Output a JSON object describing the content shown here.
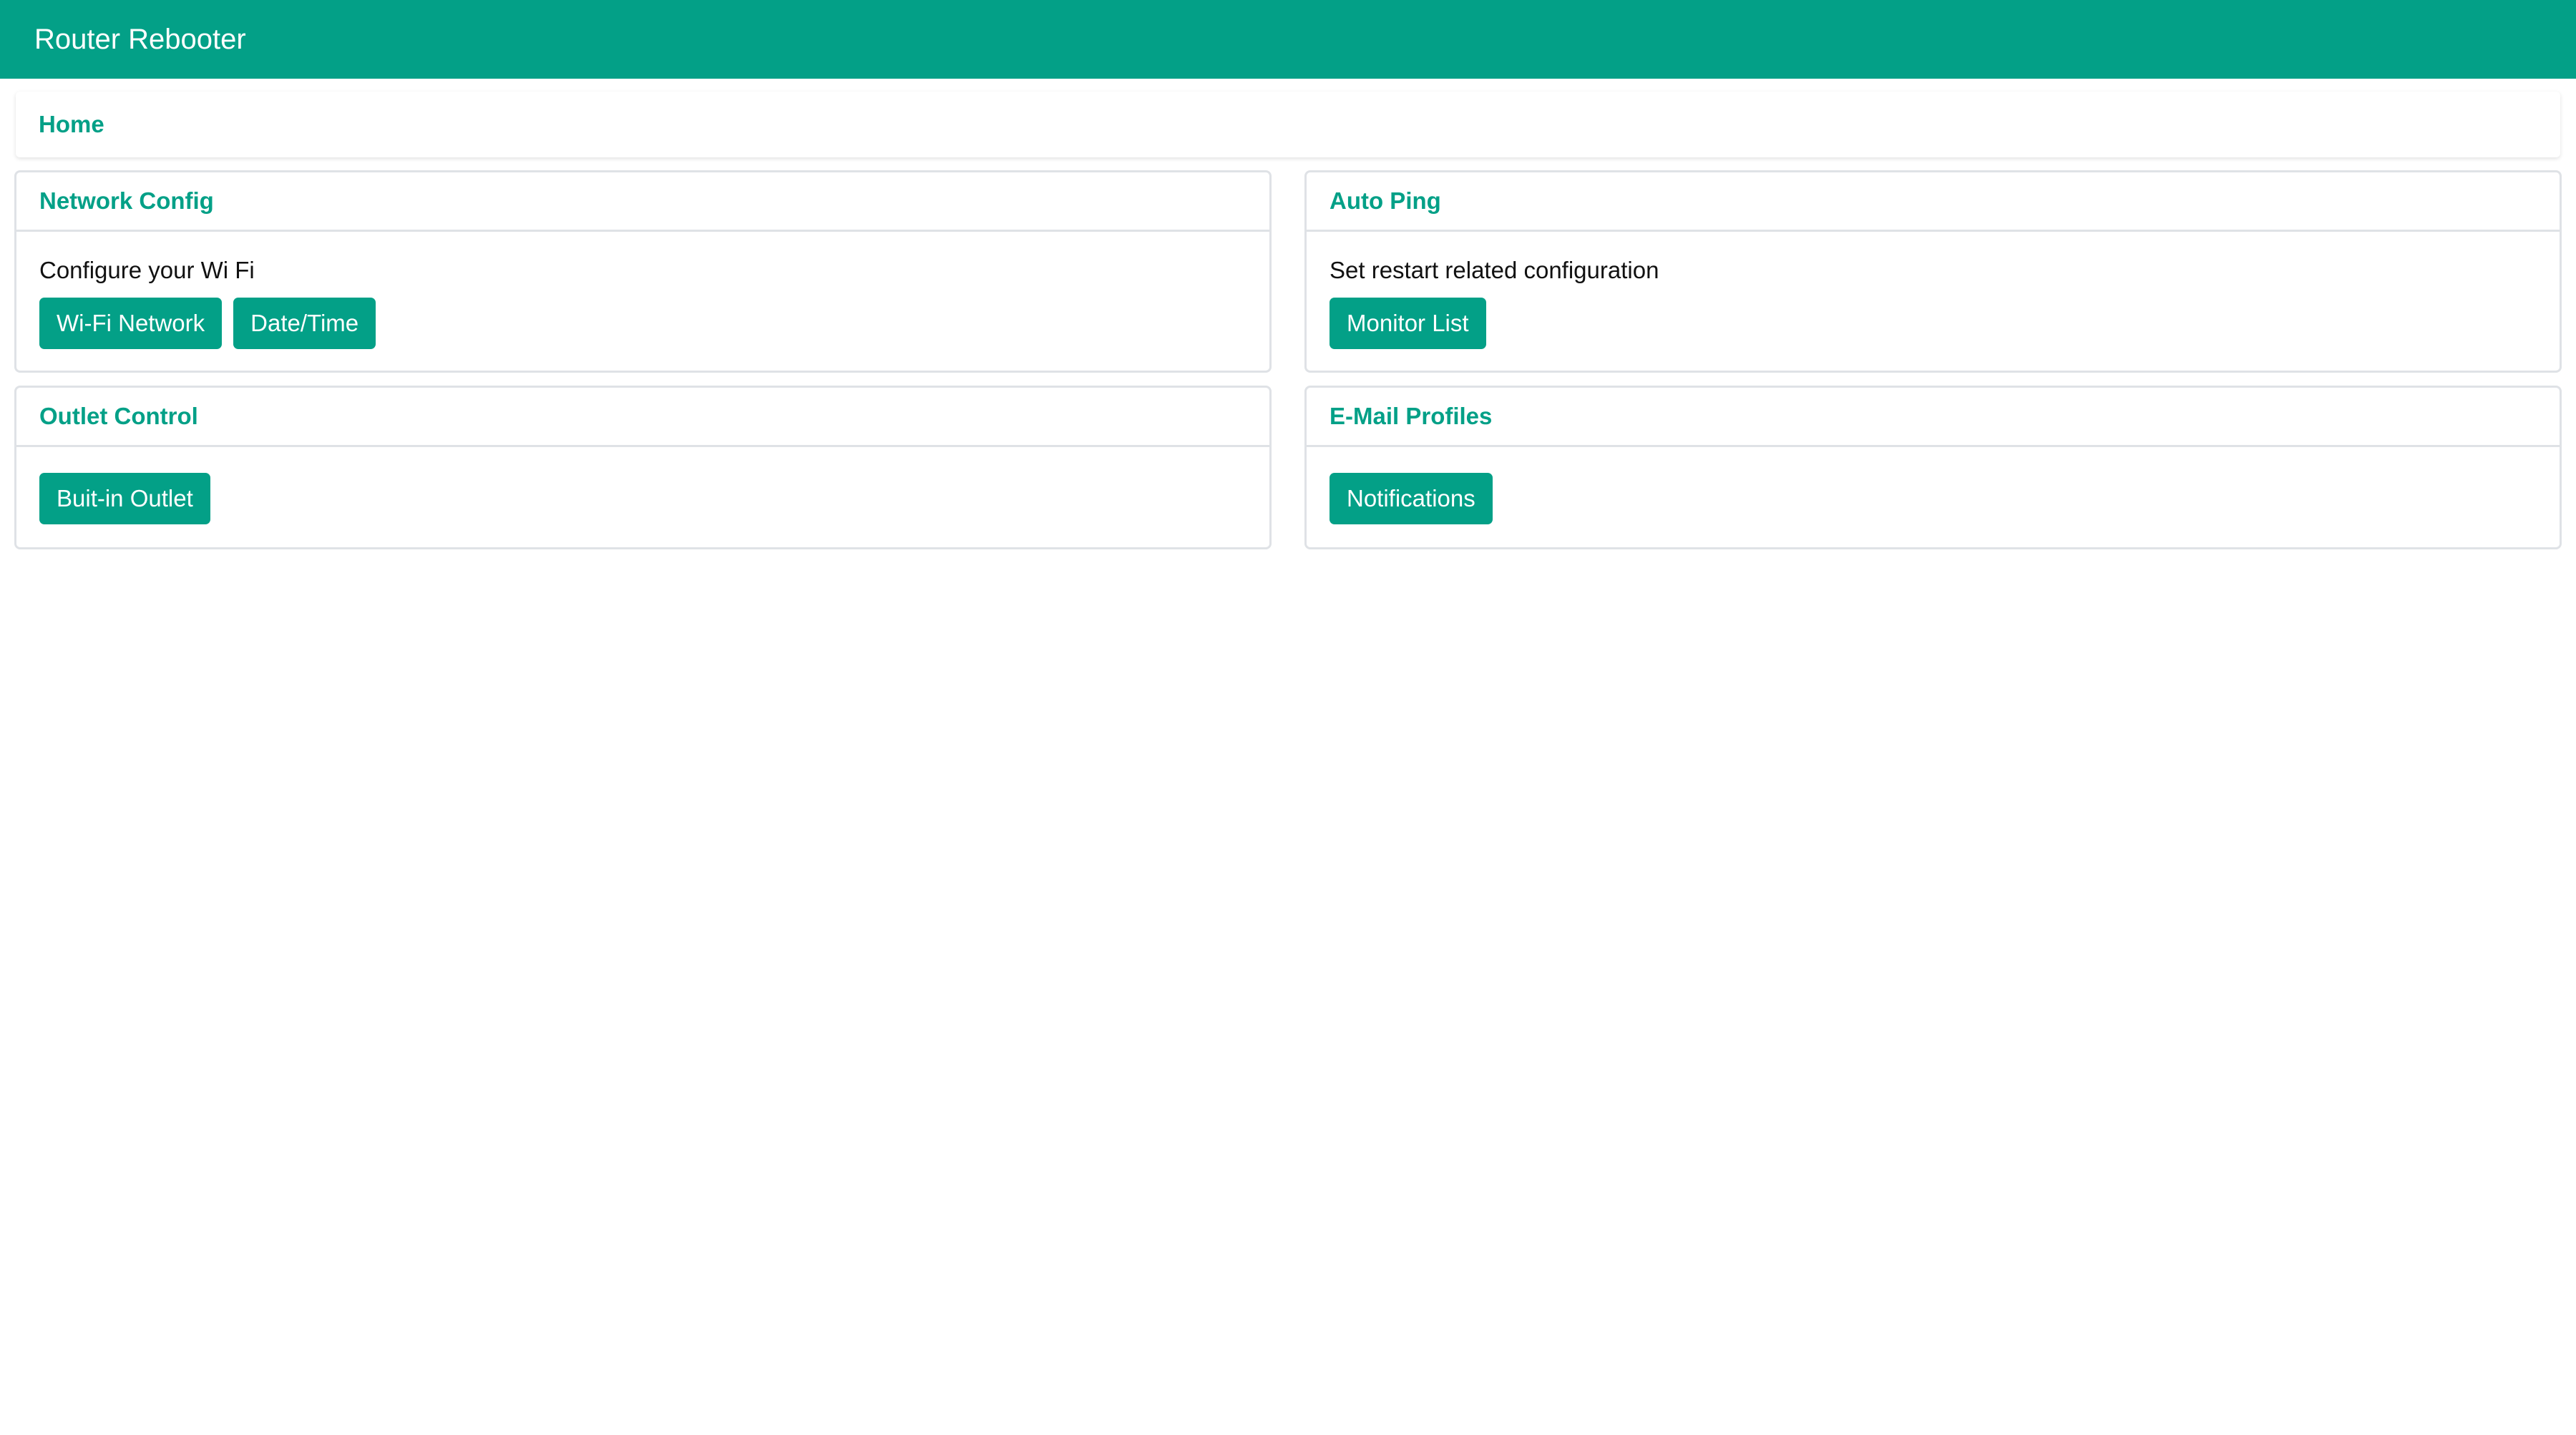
{
  "app": {
    "title": "Router Rebooter",
    "accent_color": "#03a087"
  },
  "breadcrumb": {
    "home_label": "Home"
  },
  "cards": {
    "network_config": {
      "title": "Network Config",
      "description": "Configure your Wi Fi",
      "buttons": [
        "Wi-Fi Network",
        "Date/Time"
      ]
    },
    "auto_ping": {
      "title": "Auto Ping",
      "description": "Set restart related configuration",
      "buttons": [
        "Monitor List"
      ]
    },
    "outlet_control": {
      "title": "Outlet Control",
      "buttons": [
        "Buit-in Outlet"
      ]
    },
    "email_profiles": {
      "title": "E-Mail Profiles",
      "buttons": [
        "Notifications"
      ]
    }
  }
}
